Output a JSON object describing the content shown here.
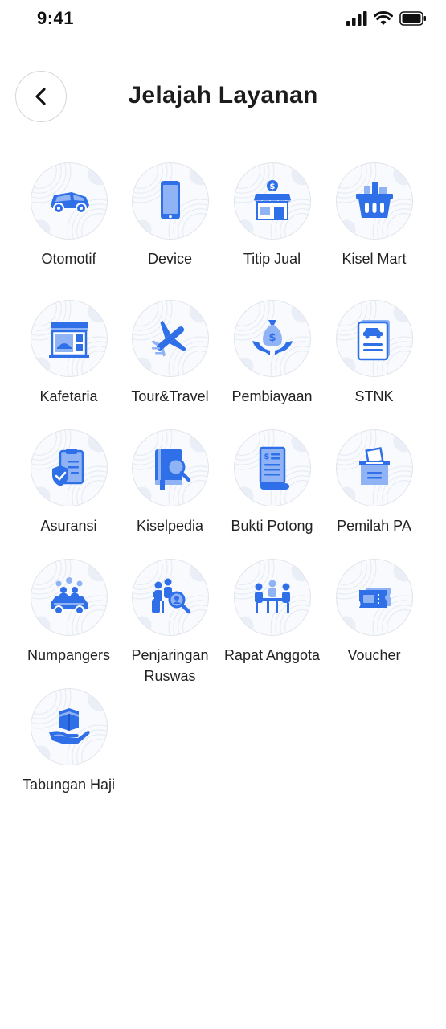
{
  "status_bar": {
    "time": "9:41"
  },
  "header": {
    "title": "Jelajah Layanan"
  },
  "services": [
    {
      "label": "Otomotif",
      "icon": "car-icon"
    },
    {
      "label": "Device",
      "icon": "phone-icon"
    },
    {
      "label": "Titip Jual",
      "icon": "store-icon"
    },
    {
      "label": "Kisel Mart",
      "icon": "basket-icon"
    },
    {
      "label": "Kafetaria",
      "icon": "cafeteria-icon"
    },
    {
      "label": "Tour&Travel",
      "icon": "airplane-icon"
    },
    {
      "label": "Pembiayaan",
      "icon": "money-bag-hands-icon"
    },
    {
      "label": "STNK",
      "icon": "vehicle-document-icon"
    },
    {
      "label": "Asuransi",
      "icon": "insurance-clipboard-icon"
    },
    {
      "label": "Kiselpedia",
      "icon": "book-search-icon"
    },
    {
      "label": "Bukti Potong",
      "icon": "receipt-icon"
    },
    {
      "label": "Pemilah PA",
      "icon": "ballot-box-icon"
    },
    {
      "label": "Numpangers",
      "icon": "carpool-icon"
    },
    {
      "label": "Penjaringan Ruswas",
      "icon": "people-search-icon"
    },
    {
      "label": "Rapat Anggota",
      "icon": "meeting-icon"
    },
    {
      "label": "Voucher",
      "icon": "ticket-icon"
    },
    {
      "label": "Tabungan Haji",
      "icon": "kaaba-hand-icon"
    }
  ],
  "colors": {
    "icon_blue": "#2f6fe8",
    "icon_light": "#8fb3f4",
    "circle_border": "#e1e4ea"
  }
}
